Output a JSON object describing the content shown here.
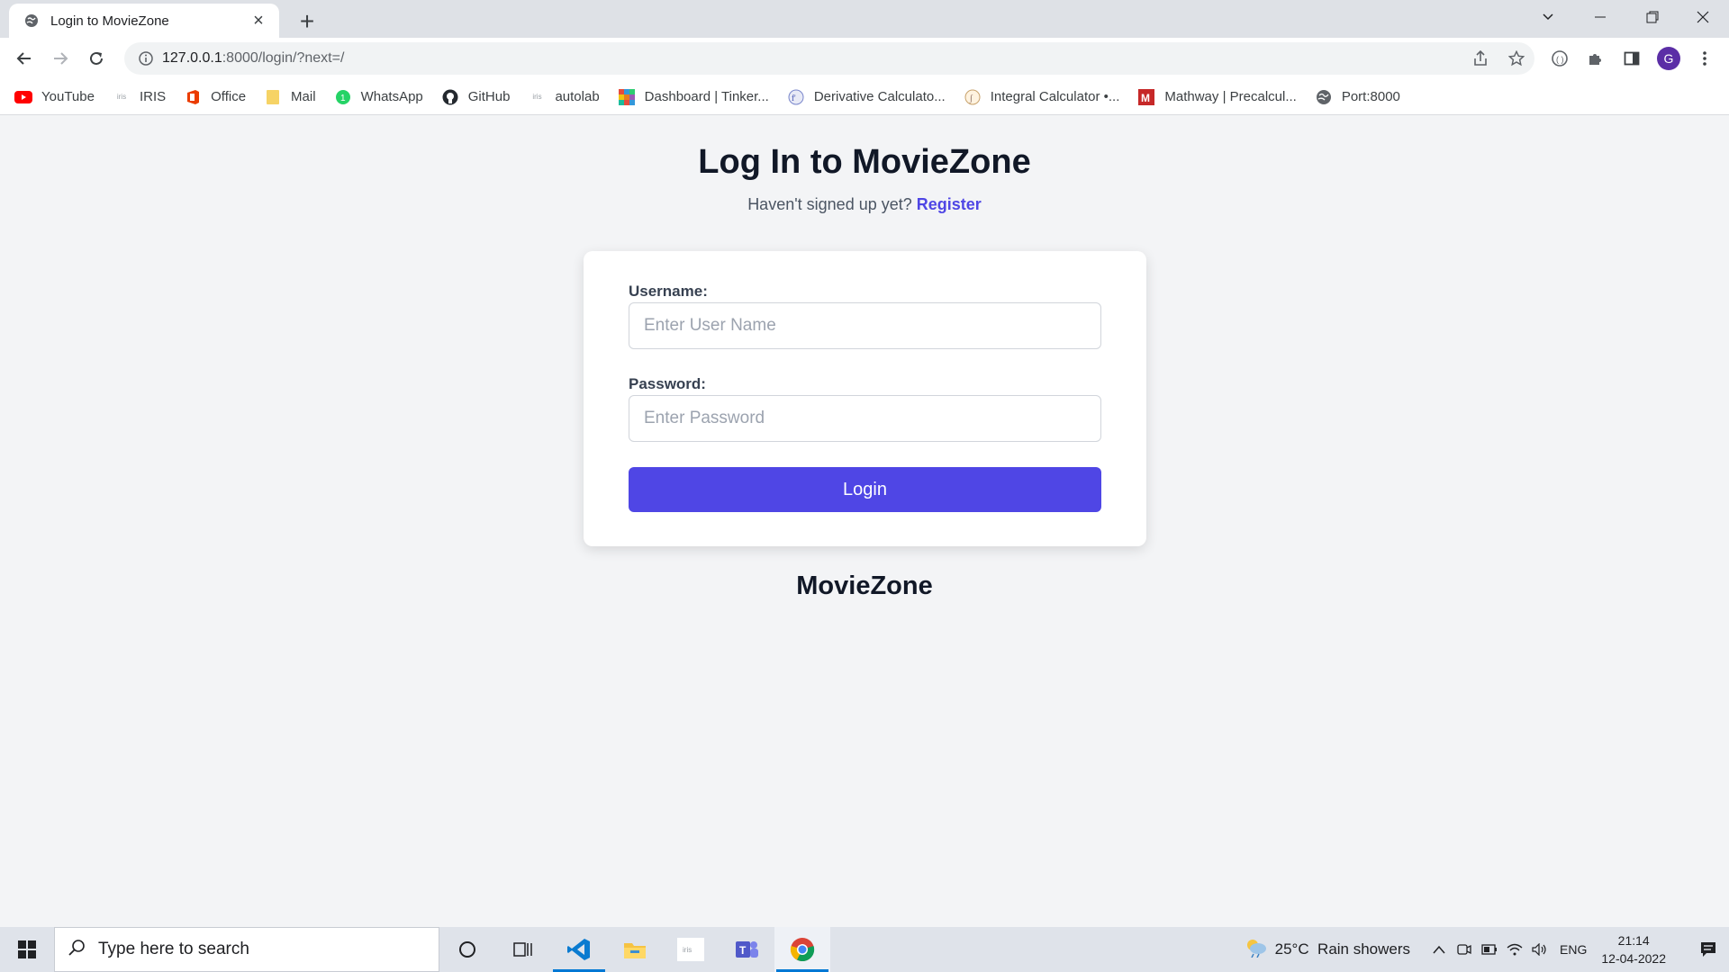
{
  "browser": {
    "tab_title": "Login to MovieZone",
    "new_tab_symbol": "+",
    "url_host": "127.0.0.1",
    "url_rest": ":8000/login/?next=/",
    "profile_initial": "G",
    "bookmarks": [
      {
        "label": "YouTube",
        "icon": "youtube-icon"
      },
      {
        "label": "IRIS",
        "icon": "iris-icon"
      },
      {
        "label": "Office",
        "icon": "office-icon"
      },
      {
        "label": "Mail",
        "icon": "folder-icon"
      },
      {
        "label": "WhatsApp",
        "icon": "whatsapp-icon"
      },
      {
        "label": "GitHub",
        "icon": "github-icon"
      },
      {
        "label": "autolab",
        "icon": "autolab-icon"
      },
      {
        "label": "Dashboard | Tinker...",
        "icon": "tinkercad-icon"
      },
      {
        "label": "Derivative Calculato...",
        "icon": "derivative-icon"
      },
      {
        "label": "Integral Calculator •...",
        "icon": "integral-icon"
      },
      {
        "label": "Mathway | Precalcul...",
        "icon": "mathway-icon"
      },
      {
        "label": "Port:8000",
        "icon": "globe-icon"
      }
    ]
  },
  "login": {
    "heading": "Log In to MovieZone",
    "signup_prompt": "Haven't signed up yet?",
    "register_link": "Register",
    "username_label": "Username:",
    "username_placeholder": "Enter User Name",
    "password_label": "Password:",
    "password_placeholder": "Enter Password",
    "login_button": "Login",
    "footer_brand": "MovieZone"
  },
  "taskbar": {
    "search_placeholder": "Type here to search",
    "weather": "25°C  Rain showers",
    "language": "ENG",
    "time": "21:14",
    "date": "12-04-2022"
  },
  "colors": {
    "accent": "#4f46e5",
    "page_bg": "#f3f4f6"
  }
}
